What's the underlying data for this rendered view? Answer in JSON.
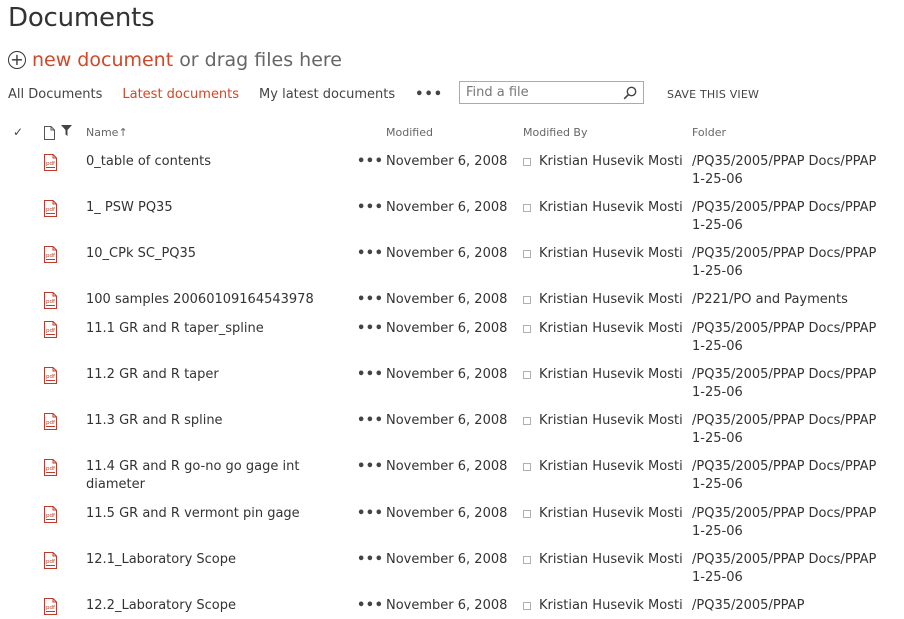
{
  "title": "Documents",
  "new_doc": {
    "link": "new document",
    "rest": "or drag files here"
  },
  "views": {
    "items": [
      "All Documents",
      "Latest documents",
      "My latest documents"
    ],
    "active_index": 1,
    "more": "•••"
  },
  "search": {
    "placeholder": "Find a file"
  },
  "save_view": "SAVE THIS VIEW",
  "columns": {
    "name": "Name",
    "modified": "Modified",
    "modified_by": "Modified By",
    "folder": "Folder"
  },
  "row_menu": "•••",
  "colors": {
    "accent": "#d24726",
    "text": "#333333",
    "muted": "#666666"
  },
  "icons": {
    "file_type": "pdf-icon"
  },
  "documents": [
    {
      "name": "0_table of contents",
      "modified": "November 6, 2008",
      "modified_by": "Kristian Husevik Mosti",
      "folder": "/PQ35/2005/PPAP Docs/PPAP 1-25-06"
    },
    {
      "name": "1_ PSW PQ35",
      "modified": "November 6, 2008",
      "modified_by": "Kristian Husevik Mosti",
      "folder": "/PQ35/2005/PPAP Docs/PPAP 1-25-06"
    },
    {
      "name": "10_CPk SC_PQ35",
      "modified": "November 6, 2008",
      "modified_by": "Kristian Husevik Mosti",
      "folder": "/PQ35/2005/PPAP Docs/PPAP 1-25-06"
    },
    {
      "name": "100 samples 20060109164543978",
      "modified": "November 6, 2008",
      "modified_by": "Kristian Husevik Mosti",
      "folder": "/P221/PO and Payments"
    },
    {
      "name": "11.1 GR and R taper_spline",
      "modified": "November 6, 2008",
      "modified_by": "Kristian Husevik Mosti",
      "folder": "/PQ35/2005/PPAP Docs/PPAP 1-25-06"
    },
    {
      "name": "11.2 GR and R taper",
      "modified": "November 6, 2008",
      "modified_by": "Kristian Husevik Mosti",
      "folder": "/PQ35/2005/PPAP Docs/PPAP 1-25-06"
    },
    {
      "name": "11.3 GR and R spline",
      "modified": "November 6, 2008",
      "modified_by": "Kristian Husevik Mosti",
      "folder": "/PQ35/2005/PPAP Docs/PPAP 1-25-06"
    },
    {
      "name": "11.4 GR and R go-no go gage int diameter",
      "modified": "November 6, 2008",
      "modified_by": "Kristian Husevik Mosti",
      "folder": "/PQ35/2005/PPAP Docs/PPAP 1-25-06"
    },
    {
      "name": "11.5 GR and R vermont pin gage",
      "modified": "November 6, 2008",
      "modified_by": "Kristian Husevik Mosti",
      "folder": "/PQ35/2005/PPAP Docs/PPAP 1-25-06"
    },
    {
      "name": "12.1_Laboratory Scope",
      "modified": "November 6, 2008",
      "modified_by": "Kristian Husevik Mosti",
      "folder": "/PQ35/2005/PPAP Docs/PPAP 1-25-06"
    },
    {
      "name": "12.2_Laboratory Scope",
      "modified": "November 6, 2008",
      "modified_by": "Kristian Husevik Mosti",
      "folder": "/PQ35/2005/PPAP"
    }
  ]
}
